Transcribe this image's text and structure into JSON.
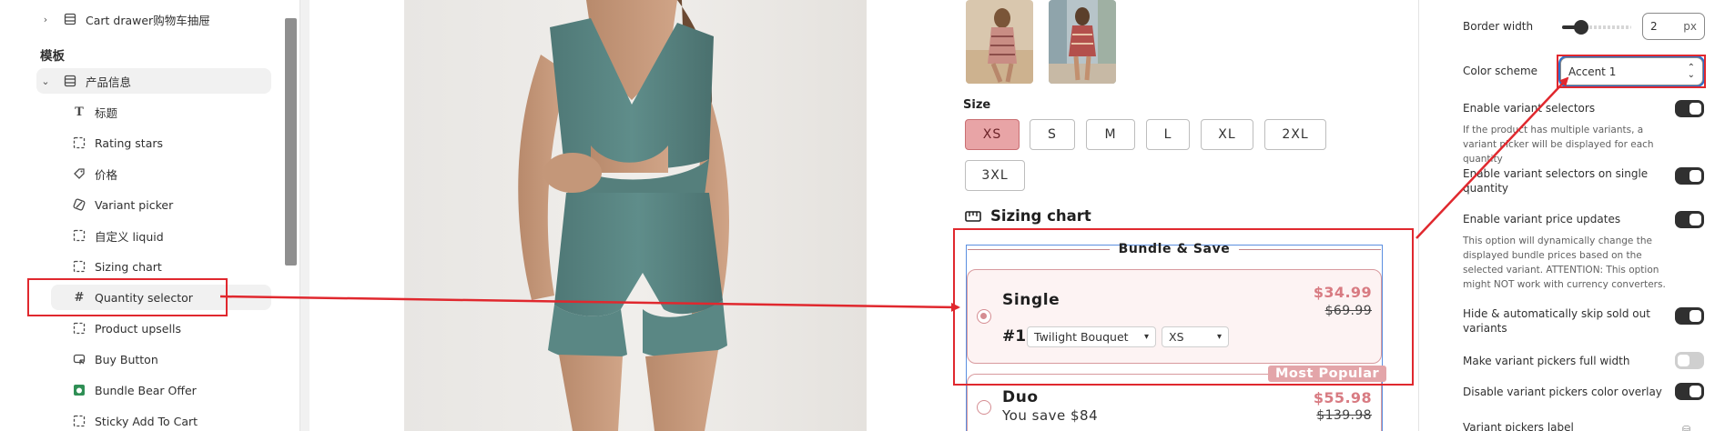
{
  "sidebar": {
    "top_item": "Cart drawer购物车抽屉",
    "section_label": "模板",
    "group_item": "产品信息",
    "blocks": [
      {
        "label": "标题"
      },
      {
        "label": "Rating stars"
      },
      {
        "label": "价格"
      },
      {
        "label": "Variant picker"
      },
      {
        "label": "自定义 liquid"
      },
      {
        "label": "Sizing chart"
      },
      {
        "label": "Quantity selector"
      },
      {
        "label": "Product upsells"
      },
      {
        "label": "Buy Button"
      },
      {
        "label": "Bundle Bear Offer"
      },
      {
        "label": "Sticky Add To Cart"
      }
    ]
  },
  "preview": {
    "size_label": "Size",
    "sizes": [
      "XS",
      "S",
      "M",
      "L",
      "XL",
      "2XL",
      "3XL"
    ],
    "selected_size": "XS",
    "sizing_chart_label": "Sizing chart",
    "bundle_title": "Bundle & Save",
    "offers": {
      "single": {
        "name": "Single",
        "price": "$34.99",
        "compare_price": "$69.99",
        "variant_no": "#1",
        "variant_option": "Twilight Bouquet",
        "size_option": "XS"
      },
      "duo": {
        "name": "Duo",
        "subtitle": "You save $84",
        "price": "$55.98",
        "compare_price": "$139.98",
        "badge": "Most Popular"
      }
    }
  },
  "settings": {
    "border_width_label": "Border width",
    "border_width_value": "2",
    "border_width_unit": "px",
    "color_scheme_label": "Color scheme",
    "color_scheme_value": "Accent 1",
    "enable_variant_selectors": "Enable variant selectors",
    "enable_variant_selectors_help": "If the product has multiple variants, a variant picker will be displayed for each quantity",
    "enable_single_quantity": "Enable variant selectors on single quantity",
    "enable_price_updates": "Enable variant price updates",
    "enable_price_updates_help": "This option will dynamically change the displayed bundle prices based on the selected variant. ATTENTION: This option might NOT work with currency converters.",
    "hide_sold_out": "Hide & automatically skip sold out variants",
    "full_width": "Make variant pickers full width",
    "disable_color_overlay": "Disable variant pickers color overlay",
    "variant_pickers_label": "Variant pickers label"
  },
  "toggles": {
    "enable_variant_selectors": true,
    "enable_single_quantity": true,
    "enable_price_updates": true,
    "hide_sold_out": true,
    "full_width": false,
    "disable_color_overlay": true
  },
  "colors": {
    "accent_pink": "#d87b82",
    "selected_size_bg": "#e8a4a6",
    "annotation_red": "#e0282e",
    "focus_blue": "#2c6ecb"
  }
}
